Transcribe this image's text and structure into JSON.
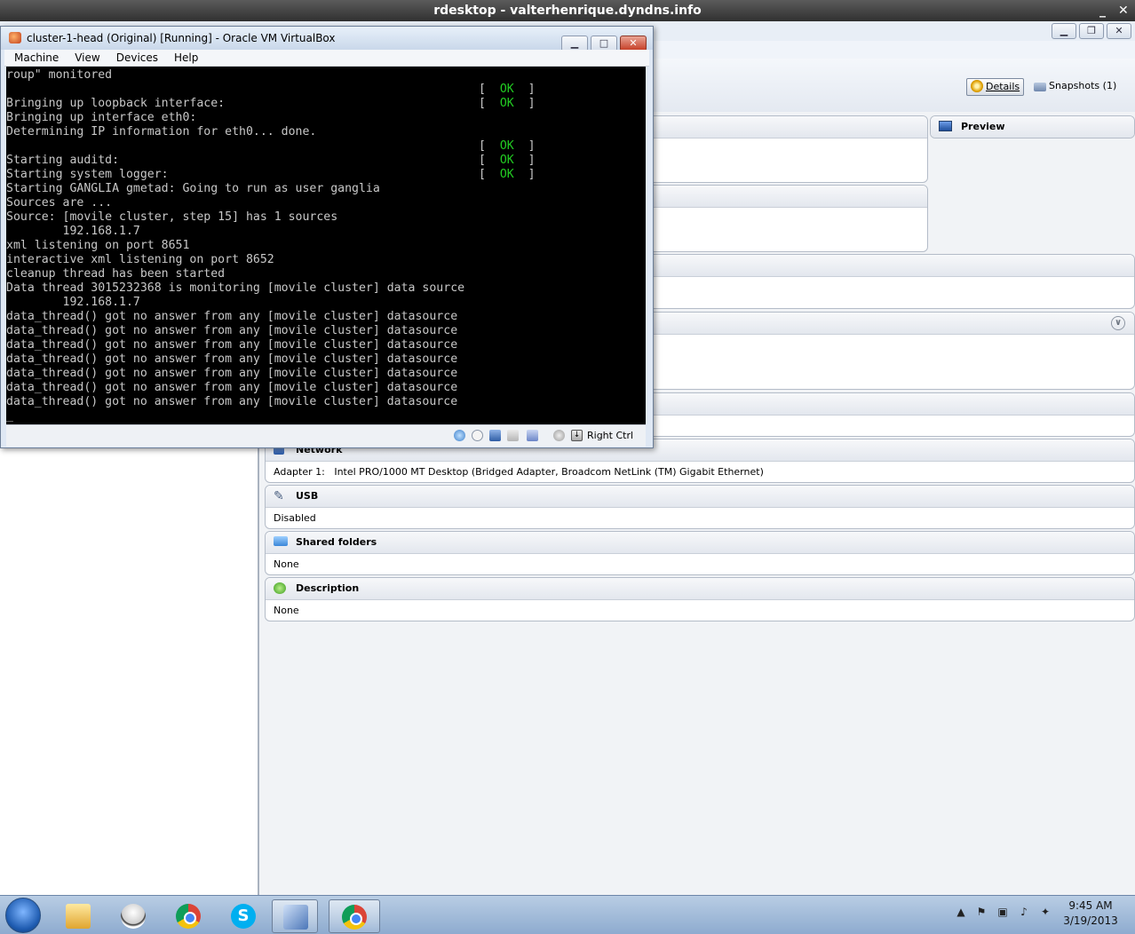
{
  "rdesktop": {
    "title": "rdesktop - valterhenrique.dyndns.info",
    "minimize": "_",
    "close": "✕"
  },
  "manager": {
    "toolbar": {
      "details_label": "Details",
      "snapshots_label": "Snapshots (1)"
    },
    "sections": {
      "preview": {
        "title": "Preview"
      },
      "network": {
        "title": "Network",
        "value": "Adapter 1:   Intel PRO/1000 MT Desktop (Bridged Adapter, Broadcom NetLink (TM) Gigabit Ethernet)"
      },
      "usb": {
        "title": "USB",
        "value": "Disabled"
      },
      "shared_folders": {
        "title": "Shared folders",
        "value": "None"
      },
      "description": {
        "title": "Description",
        "value": "None"
      }
    }
  },
  "vm_window": {
    "title": "cluster-1-head (Original) [Running] - Oracle VM VirtualBox",
    "menu": [
      "Machine",
      "View",
      "Devices",
      "Help"
    ],
    "host_key": "Right Ctrl",
    "console_lines": [
      {
        "text": "roup\" monitored",
        "ok": false
      },
      {
        "text": "",
        "ok": true
      },
      {
        "text": "Bringing up loopback interface:",
        "ok": true
      },
      {
        "text": "Bringing up interface eth0:",
        "ok": false
      },
      {
        "text": "Determining IP information for eth0... done.",
        "ok": false
      },
      {
        "text": "",
        "ok": true
      },
      {
        "text": "Starting auditd:",
        "ok": true
      },
      {
        "text": "Starting system logger:",
        "ok": true
      },
      {
        "text": "Starting GANGLIA gmetad: Going to run as user ganglia",
        "ok": false
      },
      {
        "text": "Sources are ...",
        "ok": false
      },
      {
        "text": "Source: [movile cluster, step 15] has 1 sources",
        "ok": false
      },
      {
        "text": "        192.168.1.7",
        "ok": false
      },
      {
        "text": "xml listening on port 8651",
        "ok": false
      },
      {
        "text": "interactive xml listening on port 8652",
        "ok": false
      },
      {
        "text": "cleanup thread has been started",
        "ok": false
      },
      {
        "text": "Data thread 3015232368 is monitoring [movile cluster] data source",
        "ok": false
      },
      {
        "text": "        192.168.1.7",
        "ok": false
      },
      {
        "text": "data_thread() got no answer from any [movile cluster] datasource",
        "ok": false
      },
      {
        "text": "data_thread() got no answer from any [movile cluster] datasource",
        "ok": false
      },
      {
        "text": "data_thread() got no answer from any [movile cluster] datasource",
        "ok": false
      },
      {
        "text": "data_thread() got no answer from any [movile cluster] datasource",
        "ok": false
      },
      {
        "text": "data_thread() got no answer from any [movile cluster] datasource",
        "ok": false
      },
      {
        "text": "data_thread() got no answer from any [movile cluster] datasource",
        "ok": false
      },
      {
        "text": "data_thread() got no answer from any [movile cluster] datasource",
        "ok": false
      },
      {
        "text": "_",
        "ok": false
      }
    ],
    "ok_label": "[  OK  ]"
  },
  "taskbar": {
    "items": [
      {
        "name": "windows-explorer-icon"
      },
      {
        "name": "alien-app-icon"
      },
      {
        "name": "chrome-icon"
      },
      {
        "name": "skype-icon"
      },
      {
        "name": "virtualbox-icon"
      },
      {
        "name": "chrome-icon"
      }
    ],
    "clock_time": "9:45 AM",
    "clock_date": "3/19/2013"
  },
  "colors": {
    "console_ok": "#22cc22",
    "console_text": "#c8c8c8",
    "taskbar": "#9fb8d8"
  }
}
